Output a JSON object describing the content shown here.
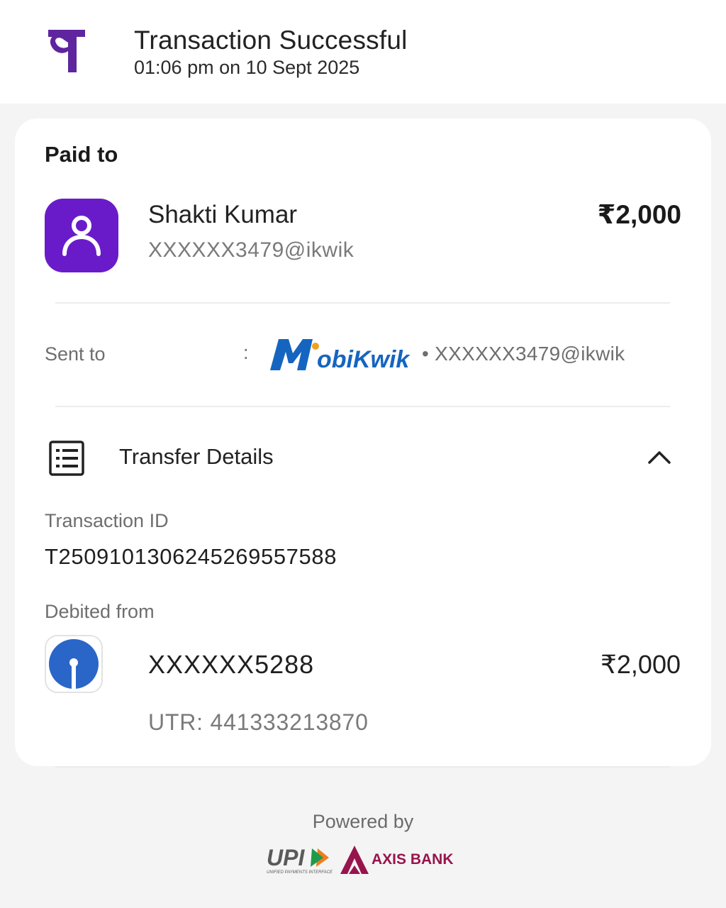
{
  "header": {
    "title": "Transaction Successful",
    "subtitle": "01:06 pm on 10 Sept 2025",
    "logo_icon": "phonepe-logo-icon",
    "brand_color": "#5f259f"
  },
  "paid_to": {
    "heading": "Paid to",
    "avatar_icon": "person-icon",
    "name": "Shakti Kumar",
    "upi_id": "XXXXXX3479@ikwik",
    "amount": "₹2,000"
  },
  "sent_to": {
    "label": "Sent to",
    "colon": ":",
    "provider_logo": "mobikwik-logo",
    "upi_id": "• XXXXXX3479@ikwik"
  },
  "transfer_details": {
    "title": "Transfer Details",
    "icon": "receipt-list-icon",
    "toggle_icon": "chevron-up-icon",
    "transaction_id_label": "Transaction ID",
    "transaction_id": "T2509101306245269557588",
    "debited_from_label": "Debited from",
    "bank_logo": "sbi-logo",
    "account": "XXXXXX5288",
    "amount": "₹2,000",
    "utr": "UTR: 441333213870"
  },
  "footer": {
    "powered_by": "Powered by",
    "upi_logo": "upi-logo",
    "upi_tagline": "UNIFIED PAYMENTS INTERFACE",
    "bank_logo": "axis-bank-logo",
    "bank_name": "AXIS BANK"
  }
}
